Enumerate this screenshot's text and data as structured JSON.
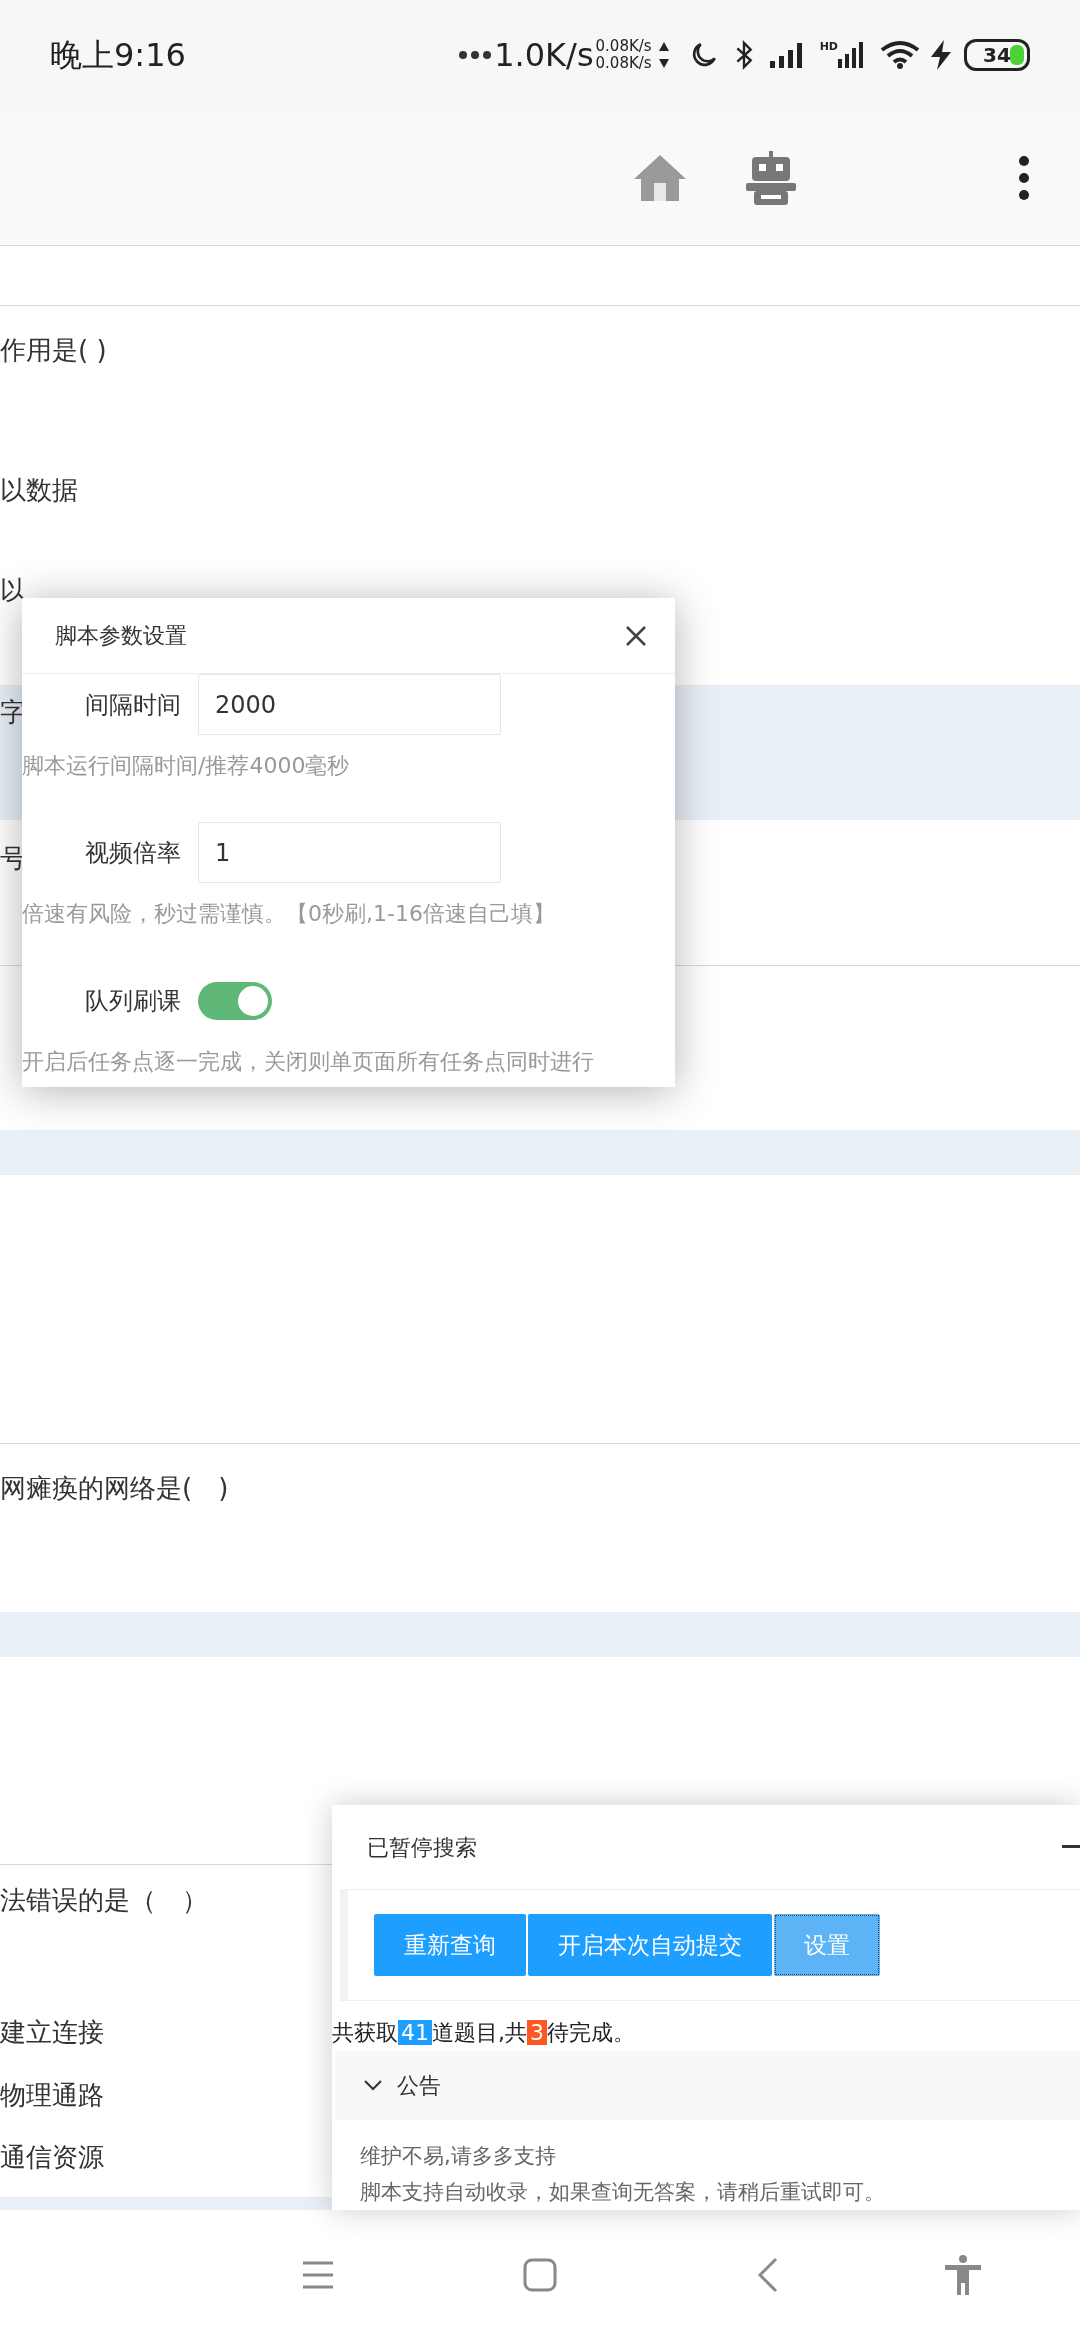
{
  "status_bar": {
    "time": "晚上9:16",
    "net_speed": "1.0K/s",
    "up_speed": "0.08K/s",
    "down_speed": "0.08K/s",
    "hd_label": "HD",
    "battery": "34"
  },
  "page_rows": [
    {
      "kind": "divider"
    },
    {
      "kind": "divider"
    },
    {
      "kind": "text",
      "text": "作用是( )"
    },
    {
      "kind": "text",
      "text": "以数据"
    },
    {
      "kind": "text",
      "text": "以"
    },
    {
      "kind": "band",
      "text": "字"
    },
    {
      "kind": "text",
      "text": "号"
    },
    {
      "kind": "divider"
    },
    {
      "kind": "band"
    },
    {
      "kind": "divider"
    },
    {
      "kind": "text",
      "text": "网瘫痪的网络是(　)"
    },
    {
      "kind": "band"
    },
    {
      "kind": "divider"
    },
    {
      "kind": "text",
      "text": "法错误的是（　）"
    },
    {
      "kind": "text",
      "text": "建立连接"
    },
    {
      "kind": "text",
      "text": "物理通路"
    },
    {
      "kind": "text",
      "text": "通信资源"
    },
    {
      "kind": "band"
    }
  ],
  "settings_dialog": {
    "title": "脚本参数设置",
    "fields": [
      {
        "kind": "input",
        "label": "间隔时间",
        "value": "2000",
        "hint": "脚本运行间隔时间/推荐4000毫秒"
      },
      {
        "kind": "input",
        "label": "视频倍率",
        "value": "1",
        "hint": "倍速有风险，秒过需谨慎。【0秒刷,1-16倍速自己填】"
      },
      {
        "kind": "switch",
        "label": "队列刷课",
        "on": true,
        "hint": "开启后任务点逐一完成，关闭则单页面所有任务点同时进行"
      }
    ]
  },
  "search_panel": {
    "title": "已暂停搜索",
    "buttons": [
      {
        "label": "重新查询",
        "focused": false
      },
      {
        "label": "开启本次自动提交",
        "focused": false
      },
      {
        "label": "设置",
        "focused": true
      }
    ],
    "summary": {
      "prefix": "共获取",
      "total": "41",
      "middle": "道题目,共",
      "pending": "3",
      "suffix": "待完成。"
    },
    "notice": {
      "title": "公告",
      "expanded": true,
      "lines": [
        "维护不易,请多多支持",
        "脚本支持自动收录，如果查询无答案，请稍后重试即可。"
      ]
    }
  }
}
